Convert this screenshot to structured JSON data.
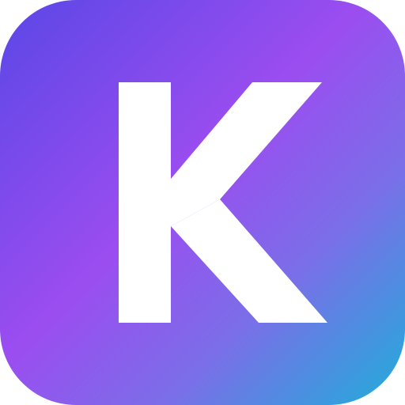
{
  "icon": {
    "letter": "K",
    "glyph_color": "#ffffff",
    "gradient": {
      "start": "#5b47e6",
      "mid": "#9b4df0",
      "end": "#1faed9"
    }
  }
}
